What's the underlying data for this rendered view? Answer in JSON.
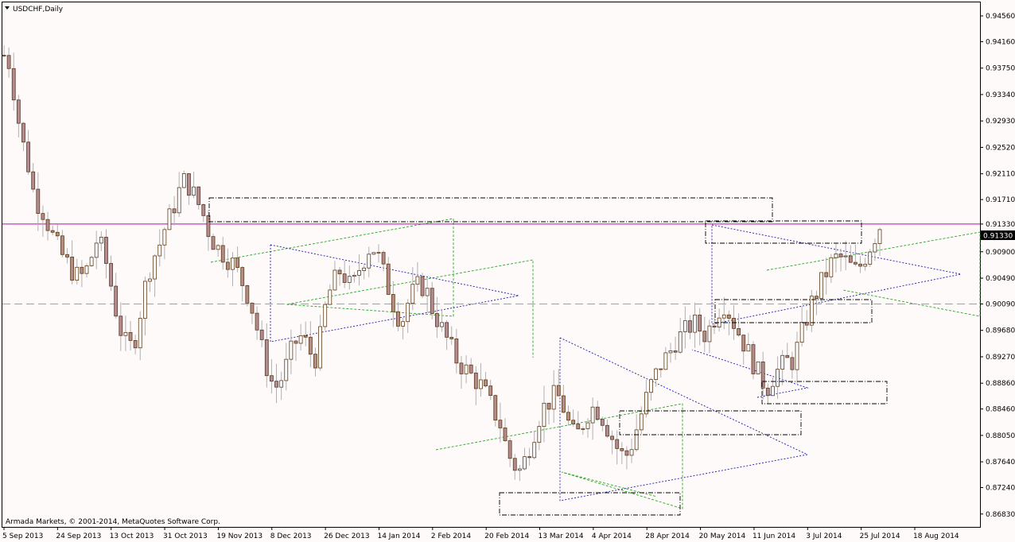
{
  "window": {
    "title": "USDCHF,Daily",
    "copyright": "Armada Markets, © 2001-2014, MetaQuotes Software Corp."
  },
  "colors": {
    "background": "#fffafa",
    "candle_border": "#5a3a1a",
    "candle_body": "#b58c8c",
    "wick": "#b0b0b0",
    "price_line": "#c000c0",
    "price_label_bg": "#000000",
    "guide_line": "#a0a0a0",
    "green_pattern": "#22aa22",
    "blue_pattern": "#1a1aaa",
    "zone": "#000000"
  },
  "chart_data": {
    "type": "candlestick",
    "symbol": "USDCHF",
    "timeframe": "Daily",
    "ylim": [
      0.8663,
      0.9477
    ],
    "y_ticks": [
      "0.94560",
      "0.94160",
      "0.93750",
      "0.93340",
      "0.92930",
      "0.92520",
      "0.92110",
      "0.91710",
      "0.91330",
      "0.90900",
      "0.90490",
      "0.90090",
      "0.89680",
      "0.89270",
      "0.88860",
      "0.88460",
      "0.88050",
      "0.87640",
      "0.87240",
      "0.86830"
    ],
    "x_ticks": [
      "5 Sep 2013",
      "24 Sep 2013",
      "13 Oct 2013",
      "31 Oct 2013",
      "19 Nov 2013",
      "8 Dec 2013",
      "26 Dec 2013",
      "14 Jan 2014",
      "2 Feb 2014",
      "20 Feb 2014",
      "13 Mar 2014",
      "4 Apr 2014",
      "28 Apr 2014",
      "20 May 2014",
      "11 Jun 2014",
      "3 Jul 2014",
      "25 Jul 2014",
      "18 Aug 2014"
    ],
    "current_price": "0.91330",
    "horizontal_line": 0.9009,
    "close_path": [
      0.9395,
      0.938,
      0.931,
      0.926,
      0.922,
      0.917,
      0.916,
      0.9135,
      0.911,
      0.909,
      0.9075,
      0.906,
      0.905,
      0.9055,
      0.908,
      0.911,
      0.909,
      0.905,
      0.9,
      0.896,
      0.894,
      0.895,
      0.9,
      0.905,
      0.908,
      0.91,
      0.913,
      0.915,
      0.918,
      0.92,
      0.919,
      0.917,
      0.915,
      0.912,
      0.91,
      0.909,
      0.908,
      0.907,
      0.905,
      0.903,
      0.9,
      0.896,
      0.892,
      0.889,
      0.888,
      0.89,
      0.893,
      0.895,
      0.896,
      0.894,
      0.892,
      0.896,
      0.902,
      0.904,
      0.906,
      0.905,
      0.903,
      0.906,
      0.908,
      0.91,
      0.909,
      0.906,
      0.903,
      0.9,
      0.898,
      0.901,
      0.903,
      0.904,
      0.903,
      0.9,
      0.898,
      0.896,
      0.894,
      0.892,
      0.891,
      0.89,
      0.889,
      0.888,
      0.886,
      0.884,
      0.882,
      0.878,
      0.876,
      0.875,
      0.877,
      0.88,
      0.883,
      0.885,
      0.886,
      0.887,
      0.885,
      0.882,
      0.88,
      0.882,
      0.884,
      0.885,
      0.884,
      0.882,
      0.88,
      0.878,
      0.877,
      0.879,
      0.882,
      0.885,
      0.888,
      0.89,
      0.892,
      0.893,
      0.895,
      0.896,
      0.897,
      0.898,
      0.897,
      0.896,
      0.898,
      0.9,
      0.901,
      0.899,
      0.897,
      0.895,
      0.893,
      0.891,
      0.889,
      0.888,
      0.89,
      0.891,
      0.892,
      0.892,
      0.895,
      0.898,
      0.901,
      0.903,
      0.905,
      0.907,
      0.908,
      0.908,
      0.907,
      0.906,
      0.907,
      0.909,
      0.911,
      0.913
    ]
  }
}
